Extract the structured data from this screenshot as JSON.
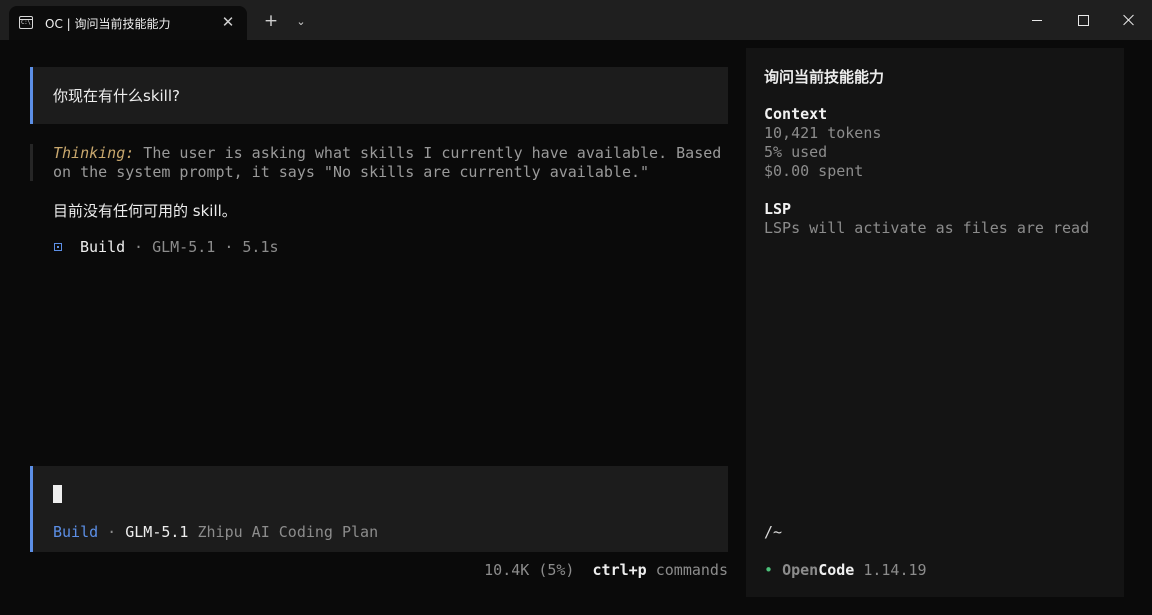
{
  "window": {
    "tab_title": "OC | 询问当前技能能力",
    "tab_icon": "terminal-icon",
    "tab_icon_text": "C:\\",
    "close_tab_glyph": "✕",
    "new_tab_glyph": "+",
    "dropdown_glyph": "⌄"
  },
  "conversation": {
    "user_message": "你现在有什么skill?",
    "thinking_label": "Thinking:",
    "thinking_line1": " The user is asking what skills I currently have available. Based",
    "thinking_line2": "on the system prompt, it says \"No skills are currently available.\"",
    "assistant_reply": "目前没有任何可用的 skill。",
    "build": {
      "agent": "Build",
      "meta": " · GLM-5.1 · 5.1s"
    }
  },
  "input": {
    "agent": "Build",
    "separator": " · ",
    "model": "GLM-5.1",
    "provider": " Zhipu AI Coding Plan"
  },
  "footer": {
    "usage": "10.4K (5%)",
    "shortcut_key": "ctrl+p",
    "shortcut_label": " commands"
  },
  "sidebar": {
    "title": "询问当前技能能力",
    "context_heading": "Context",
    "tokens": "10,421 tokens",
    "used": "5% used",
    "spent": "$0.00 spent",
    "lsp_heading": "LSP",
    "lsp_status": "LSPs will activate as files are read",
    "path": "/~",
    "dot": "•",
    "brand_open": "Open",
    "brand_code": "Code",
    "version": " 1.14.19"
  },
  "colors": {
    "accent": "#5c8fe6",
    "thinking_label": "#c9a86e",
    "status_dot": "#4cc27a",
    "background": "#0a0a0a",
    "panel": "#1c1c1c",
    "sidebar": "#141414"
  }
}
